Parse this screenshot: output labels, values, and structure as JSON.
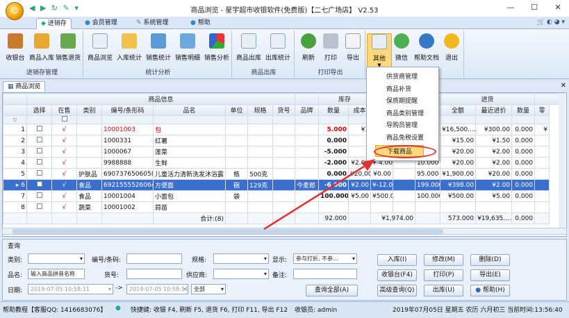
{
  "window": {
    "title": "商品浏览 - 星宇超市收银软件(免费版)【二七广场店】 V2.53",
    "min": "—",
    "max": "☐",
    "close": "✕"
  },
  "ribbon_tabs": [
    "进销存",
    "会员管理",
    "系统管理",
    "帮助"
  ],
  "ribbon": {
    "groups": [
      {
        "label": "进销存管理",
        "buttons": [
          "收银台",
          "商品入库",
          "销售退货"
        ]
      },
      {
        "label": "统计分析",
        "buttons": [
          "商品浏览",
          "入库统计",
          "销售统计",
          "销售明细",
          "销售分析"
        ]
      },
      {
        "label": "商品出库",
        "buttons": [
          "商品出库",
          "出库统计"
        ]
      },
      {
        "label": "打印导出",
        "buttons": [
          "刷新",
          "打印",
          "导出"
        ]
      },
      {
        "label": "",
        "buttons": [
          "其他",
          "微信",
          "帮助文档",
          "退出"
        ]
      }
    ]
  },
  "dropdown_items": [
    "供货商管理",
    "商品补货",
    "保质期提醒",
    "商品类别管理",
    "导购员管理",
    "商品免税设置",
    "下载商品"
  ],
  "doc_tab": "商品浏览",
  "grid": {
    "group_headers": {
      "info": "商品信息",
      "stock": "库存",
      "in": "进货"
    },
    "columns": [
      "选择",
      "在售",
      "类别",
      "编号/条形码",
      "品名",
      "单位",
      "规格",
      "货号",
      "品牌",
      "数量",
      "成本",
      "",
      "",
      "数量",
      "全额",
      "最近进价",
      "数量",
      "零"
    ],
    "rows": [
      {
        "n": "1",
        "onsale": "√",
        "cat": "",
        "code": "10001003",
        "name": "包",
        "unit": "",
        "spec": "",
        "sku": "",
        "brand": "",
        "qty": "5.000",
        "cost": "¥3",
        "a": "",
        "b": "",
        "inqty": "0.000",
        "amt": "¥16,500....",
        "last": "¥300.00",
        "q2": "0.000",
        "z": "¥",
        "red": true
      },
      {
        "n": "2",
        "onsale": "√",
        "cat": "",
        "code": "1000331",
        "name": "红薯",
        "unit": "",
        "spec": "",
        "sku": "",
        "brand": "",
        "qty": "0.000",
        "cost": "",
        "a": "",
        "b": "",
        "inqty": "10.000",
        "amt": "¥15.00",
        "last": "¥1.50",
        "q2": "0.000",
        "z": "",
        "red": false
      },
      {
        "n": "3",
        "onsale": "√",
        "cat": "",
        "code": "1000067",
        "name": "莲菜",
        "unit": "",
        "spec": "",
        "sku": "",
        "brand": "",
        "qty": "-5.000",
        "cost": "",
        "a": "",
        "b": "",
        "inqty": "10.000",
        "amt": "¥20.00",
        "last": "¥2.00",
        "q2": "0.000",
        "z": "",
        "red": false
      },
      {
        "n": "4",
        "onsale": "√",
        "cat": "",
        "code": "9988888",
        "name": "生鲜",
        "unit": "",
        "spec": "",
        "sku": "",
        "brand": "",
        "qty": "-2.000",
        "cost": "¥2.00",
        "a": "¥-4.00",
        "b": "",
        "inqty": "10.000",
        "amt": "¥20.00",
        "last": "¥2.00",
        "q2": "0.000",
        "z": "",
        "red": false
      },
      {
        "n": "5",
        "onsale": "√",
        "cat": "护肤品",
        "code": "6907376506058",
        "name": "儿童活力清新洗发沐浴露",
        "unit": "瓶",
        "spec": "500克",
        "sku": "",
        "brand": "",
        "qty": "0.000",
        "cost": "¥20.00",
        "a": "¥0.00",
        "b": "",
        "inqty": "95.000",
        "amt": "¥1,900.00",
        "last": "¥20.00",
        "q2": "0.000",
        "z": "",
        "red": false
      },
      {
        "n": "6",
        "onsale": "√",
        "cat": "食品",
        "code": "6921555526064",
        "name": "方便面",
        "unit": "碗",
        "spec": "129克",
        "sku": "",
        "brand": "今麦郎",
        "qty": "-6.000",
        "cost": "¥2.00",
        "a": "¥-12.00",
        "b": "",
        "inqty": "199.000",
        "amt": "¥398.00",
        "last": "¥2.00",
        "q2": "0.000",
        "z": "",
        "red": false,
        "selected": true
      },
      {
        "n": "7",
        "onsale": "√",
        "cat": "食品",
        "code": "10001004",
        "name": "小面包",
        "unit": "袋",
        "spec": "",
        "sku": "",
        "brand": "",
        "qty": "100.000",
        "cost": "¥5.00",
        "a": "¥500.00",
        "b": "",
        "inqty": "100.000",
        "amt": "¥500.00",
        "last": "¥5.00",
        "q2": "0.000",
        "z": "",
        "red": false
      },
      {
        "n": "8",
        "onsale": "√",
        "cat": "蔬菜",
        "code": "10001002",
        "name": "蒜苗",
        "unit": "",
        "spec": "",
        "sku": "",
        "brand": "",
        "qty": "",
        "cost": "",
        "a": "",
        "b": "",
        "inqty": "",
        "amt": "",
        "last": "",
        "q2": "",
        "z": "",
        "red": false
      }
    ],
    "footer": {
      "label": "合计:(8)",
      "qty": "92.000",
      "a": "¥1,974.00",
      "inqty": "573.000",
      "amt": "¥19,635....",
      "q2": "0.000"
    }
  },
  "query": {
    "title": "查询",
    "labels": {
      "category": "类别:",
      "code": "编号/条码:",
      "spec": "规格:",
      "display": "显示:",
      "name": "品名:",
      "sku": "货号:",
      "supplier": "供应商:",
      "note": "备注:",
      "date": "日期:"
    },
    "values": {
      "display": "参与打折, 不参...",
      "name": "输入商品拼音名称",
      "date_from": "2019-07-05 10:58:11",
      "date_to": "2019-07-05 10:58:11",
      "range": "全部"
    },
    "buttons": [
      "入库(I)",
      "修改(M)",
      "删除(D)",
      "收银台(F4)",
      "打印(P)",
      "导出(E)",
      "查询全部(A)",
      "高级查询(Q)",
      "出库(U)",
      "帮助(H)"
    ]
  },
  "status": {
    "left": "帮助教程【客服QQ: 1416683076】",
    "shortcuts": "快捷键: 收银 F4, 刷新 F5, 退货 F6, 打印 F11, 导出 F12",
    "cashier": "收银员: admin",
    "datetime": "2019年07月05日 星期五 农历 六月初三 当前时间:13:56:40"
  }
}
